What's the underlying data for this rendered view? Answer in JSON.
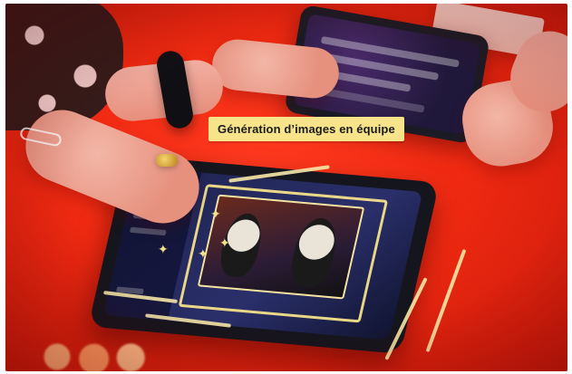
{
  "photo": {
    "caption": "Génération d’images en équipe"
  }
}
